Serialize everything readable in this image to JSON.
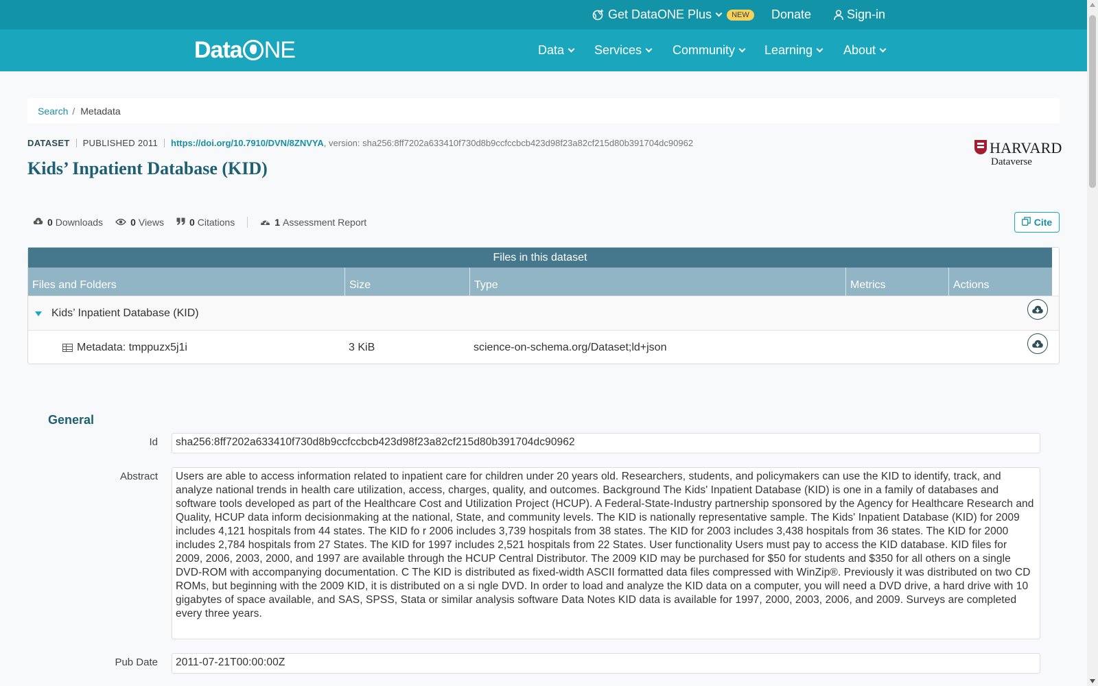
{
  "topbar": {
    "plus_label": "Get DataONE Plus",
    "new_badge": "NEW",
    "donate_label": "Donate",
    "signin_label": "Sign-in"
  },
  "nav": {
    "logo_text_a": "Data",
    "logo_text_b": "NE",
    "items": [
      "Data",
      "Services",
      "Community",
      "Learning",
      "About"
    ]
  },
  "breadcrumb": {
    "search": "Search",
    "sep": "/",
    "current": "Metadata"
  },
  "header": {
    "type_label": "DATASET",
    "published": "PUBLISHED 2011",
    "doi": "https://doi.org/10.7910/DVN/8ZNVYA",
    "version": ", version: sha256:8ff7202a633410f730d8b9ccfccbcb423d98f23a82cf215d80b391704dc90962",
    "title": "Kids’ Inpatient Database (KID)"
  },
  "repository": {
    "name": "HARVARD",
    "sub": "Dataverse"
  },
  "metrics": {
    "downloads_count": "0",
    "downloads_label": "Downloads",
    "views_count": "0",
    "views_label": "Views",
    "citations_count": "0",
    "citations_label": "Citations",
    "assessment_count": "1",
    "assessment_label": "Assessment Report",
    "cite_label": "Cite"
  },
  "files": {
    "caption": "Files in this dataset",
    "columns": [
      "Files and Folders",
      "Size",
      "Type",
      "Metrics",
      "Actions"
    ],
    "folder": {
      "name": "Kids’ Inpatient Database (KID)"
    },
    "file": {
      "name": "Metadata: tmppuzx5j1i",
      "size": "3 KiB",
      "type": "science-on-schema.org/Dataset;ld+json"
    }
  },
  "general": {
    "heading": "General",
    "id_label": "Id",
    "id_value": "sha256:8ff7202a633410f730d8b9ccfccbcb423d98f23a82cf215d80b391704dc90962",
    "abstract_label": "Abstract",
    "abstract_value": "Users are able to access information related to inpatient care for children under 20 years old. Researchers, students, and policymakers can use the KID to identify, track, and analyze national trends in health care utilization, access, charges, quality, and outcomes. Background The Kids' Inpatient Database (KID) is one in a family of databases and software tools developed as part of the Healthcare Cost and Utilization Project (HCUP). A Federal-State-Industry partnership sponsored by the Agency for Healthcare Research and Quality, HCUP data inform decisionmaking at the national, State, and community levels. The KID is nationally representative sample. The Kids' Inpatient Database (KID) for 2009 includes 4,121 hospitals from 44 states. The KID fo r 2006 includes 3,739 hospitals from 38 states. The KID for 2003 includes 3,438 hospitals from 36 states. The KID for 2000 includes 2,784 hospitals from 27 States. The KID for 1997 includes 2,521 hospitals from 22 States. User functionality Users must pay to access the KID database. KID files for 2009, 2006, 2003, 2000, and 1997 are available through the HCUP Central Distributor. The 2009 KID may be purchased for $50 for students and $350 for all others on a single DVD-ROM with accompanying documentation. C The KID is distributed as fixed-width ASCII formatted data files compressed with WinZip®. Previously it was distributed on two CD ROMs, but beginning with the 2009 KID, it is distributed on a si ngle DVD. In order to load and analyze the KID data on a computer, you will need a DVD drive, a hard drive with 10 gigabytes of space available, and SAS, SPSS, Stata or similar analysis software Data Notes KID data is available for 1997, 2000, 2003, 2006, and 2009. Surveys are completed every three years.",
    "pubdate_label": "Pub Date",
    "pubdate_value": "2011-07-21T00:00:00Z"
  },
  "colors": {
    "topbar": "#1393a8",
    "navbar": "#1aa7bd",
    "table_caption": "#46788d",
    "table_header": "#91b5c4",
    "title": "#1e5f72",
    "link": "#1a8fa3",
    "badge": "#f6d15a"
  }
}
